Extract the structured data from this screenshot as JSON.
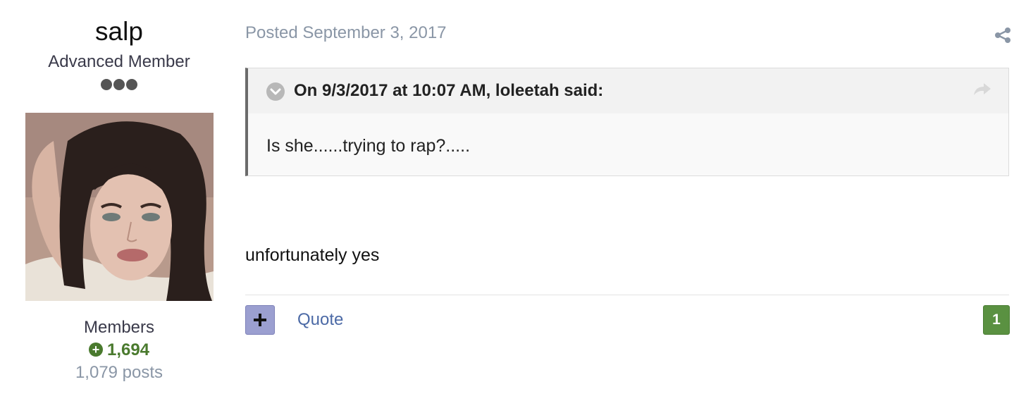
{
  "author": {
    "name": "salp",
    "rank": "Advanced Member",
    "group": "Members",
    "reputation": "1,694",
    "posts": "1,079 posts",
    "rank_pips": 3,
    "rep_icon": "plus-circle-icon"
  },
  "post": {
    "posted_label": "Posted September 3, 2017",
    "quote": {
      "citation": "On 9/3/2017 at 10:07 AM, loleetah said:",
      "text": "Is she......trying to rap?....."
    },
    "content": "unfortunately yes"
  },
  "actions": {
    "react_icon": "plus-icon",
    "quote_label": "Quote",
    "reaction_count": "1",
    "share_icon": "share-icon"
  },
  "colors": {
    "reputation_green": "#4a7a2e",
    "reaction_badge": "#5a9141",
    "react_button": "#9b9fd0",
    "link_blue": "#4c6aa6",
    "meta_gray": "#8a96a6"
  }
}
